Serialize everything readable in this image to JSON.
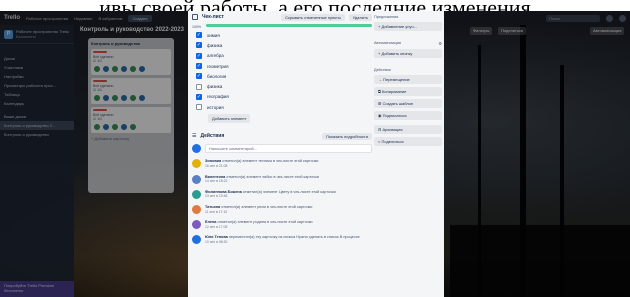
{
  "caption": "...ивы своей работы, а его последние изменения...",
  "topbar": {
    "logo": "Trello",
    "menus": [
      "Рабочие пространства",
      "Недавние",
      "В избранном"
    ],
    "create": "Создать",
    "search_placeholder": "Поиск"
  },
  "sidebar": {
    "workspace_name": "Рабочее пространство Trello",
    "workspace_sub": "Бесплатно",
    "items": [
      "Доски",
      "Участники",
      "Настройки",
      "Просмотры рабочего прос...",
      "Таблица",
      "Календарь",
      "Ваши доски",
      "Контроль и руководство 2...",
      "Контроль и руководство"
    ],
    "footer": "Попробуйте Trello Premium бесплатно"
  },
  "board": {
    "title": "Контроль и руководство 2022-2023",
    "list_title": "Контроль и руководство",
    "cards": [
      {
        "text": "Всё сделано",
        "meta": "☑ 1/1"
      },
      {
        "text": "Всё сделано",
        "meta": "☑ 1/1"
      },
      {
        "text": "Всё сделано",
        "meta": "☑ 1/1"
      }
    ],
    "add_card": "+ Добавить карточку",
    "right_buttons": [
      "Фильтры",
      "Поделиться",
      "Автоматизация"
    ]
  },
  "checklist": {
    "title": "Чек-лист",
    "hide_button": "Скрывать отмеченные пункты",
    "delete_button": "Удалить",
    "percent": "100%",
    "progress": 1.0,
    "items": [
      {
        "label": "химия",
        "checked": true
      },
      {
        "label": "физика",
        "checked": true
      },
      {
        "label": "алгебра",
        "checked": true
      },
      {
        "label": "геометрия",
        "checked": true
      },
      {
        "label": "биология",
        "checked": true
      },
      {
        "label": "физика",
        "checked": false
      },
      {
        "label": "география",
        "checked": true
      },
      {
        "label": "история",
        "checked": false
      }
    ],
    "add_item": "Добавить элемент"
  },
  "activity": {
    "title": "Действия",
    "details_button": "Показать подробности",
    "comment_placeholder": "Напишите комментарий...",
    "entries": [
      {
        "user": "Зиновия",
        "text": "отметил(а) элемент техника в чек-листе этой карточки",
        "time": "16 сен в 21:08",
        "color": "#e2b203"
      },
      {
        "user": "Валентина",
        "text": "отметил(а) элемент хибис в чек-листе этой карточки",
        "time": "14 сен в 18:22",
        "color": "#5b7fc7"
      },
      {
        "user": "Филиппова Божена",
        "text": "отметил(а) элемент Цвету в чек-листе этой карточки",
        "time": "13 сен в 19:46",
        "color": "#2a9d8f"
      },
      {
        "user": "Татьяна",
        "text": "отметил(а) элемент ресм в чек-листе этой карточки",
        "time": "11 сен в 17:10",
        "color": "#e07a3f"
      },
      {
        "user": "Елена",
        "text": "отметил(а) элемент родина в чек-листе этой карточки",
        "time": "12 сен в 17:05",
        "color": "#7c5cbf"
      },
      {
        "user": "Юля Тепова",
        "text": "переместил(а) эту карточку из списка Нужно сделать в список В процессе",
        "time": "10 сен в 08:30",
        "color": "#1f6fe0"
      }
    ]
  },
  "side": {
    "labels_title": "Предложения",
    "add_ideas": "+ Добавление улуч...",
    "automation_title": "Автоматизация",
    "add_button": "+ Добавить кнопку",
    "actions_title": "Действия",
    "actions": [
      "→ Перемещение",
      "⧉ Копирование",
      "⊞ Создать шаблон",
      "◉ Подписаться",
      "⊟ Архивация",
      "< Поделиться"
    ]
  }
}
